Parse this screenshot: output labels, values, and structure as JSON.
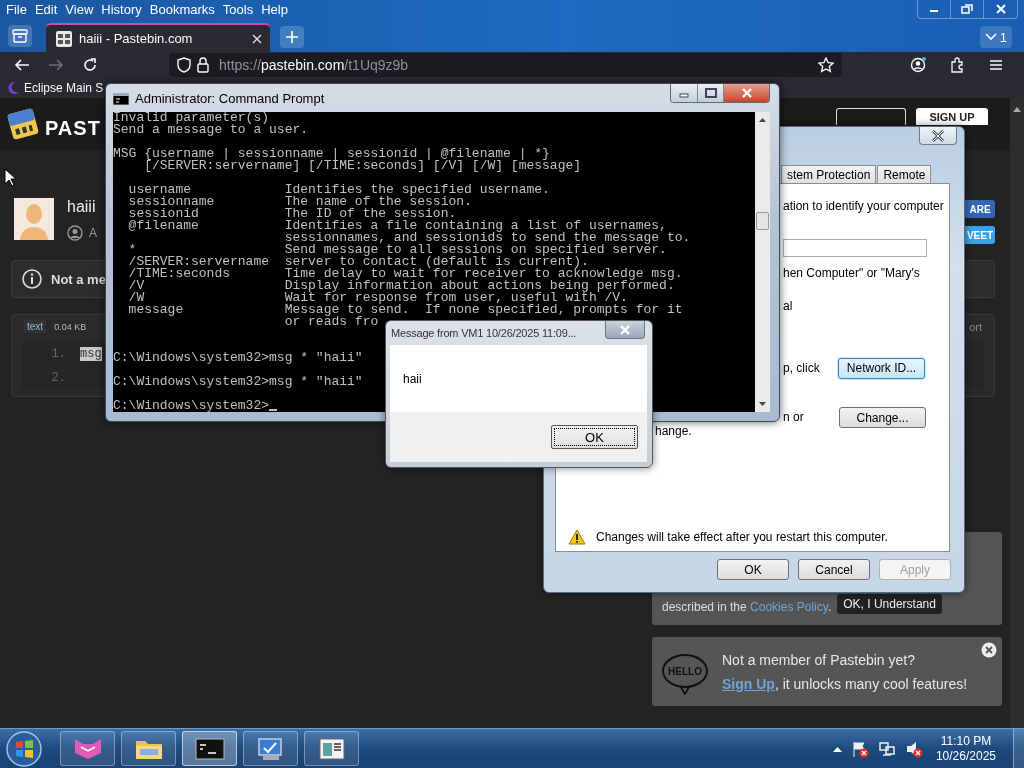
{
  "browser": {
    "menu": [
      "File",
      "Edit",
      "View",
      "History",
      "Bookmarks",
      "Tools",
      "Help"
    ],
    "tabs": [
      {
        "title": "haiii - Pastebin.com",
        "selected": true
      }
    ],
    "tab_count": "1",
    "url": {
      "scheme": "https://",
      "host": "pastebin.com",
      "path": "/t1Uq9z9b"
    },
    "bookmarks": [
      "Eclipse Main S"
    ]
  },
  "pastebin": {
    "logo_text": "PAST",
    "signup_button": "SIGN UP",
    "paste_title": "haiii",
    "author": "A",
    "notice": "Not a me",
    "syntax": "text",
    "size": "0.04 KB",
    "report": "ort",
    "share_buttons": [
      "ARE",
      "VEET"
    ],
    "lines": [
      {
        "number": "1.",
        "text": "msg",
        "selected": true
      },
      {
        "number": "2.",
        "selected": false
      }
    ],
    "cookie_banner": {
      "text": "described in the ",
      "link": "Cookies Policy",
      "after": ".",
      "button": "OK, I Understand"
    },
    "signup_banner": {
      "badge": "HELLO",
      "title": "Not a member of Pastebin yet?",
      "link": "Sign Up",
      "text": ", it unlocks many cool features!"
    }
  },
  "system_properties": {
    "tabs": [
      {
        "label": "stem Protection",
        "selected": false
      },
      {
        "label": "Remote",
        "selected": false
      }
    ],
    "description": "ation to identify your computer",
    "example": "hen Computer\" or \"Mary's",
    "label": "al",
    "network_text": "p, click",
    "network_button": "Network ID...",
    "change_text": [
      "n or",
      "hange."
    ],
    "change_button": "Change...",
    "warning": "Changes will take effect after you restart this computer.",
    "buttons": [
      {
        "label": "OK",
        "disabled": false
      },
      {
        "label": "Cancel",
        "disabled": false
      },
      {
        "label": "Apply",
        "disabled": true
      }
    ]
  },
  "command_prompt": {
    "title": "Administrator:  Command Prompt",
    "help": [
      [
        "Invalid parameter(s)",
        "Send a message to a user."
      ],
      [
        "MSG {username | sessionname | sessionid | @filename | *}",
        "    [/SERVER:servername] [/TIME:seconds] [/V] [/W] [message]"
      ],
      [
        "  username            Identifies the specified username.",
        "  sessionname         The name of the session.",
        "  sessionid           The ID of the session.",
        "  @filename           Identifies a file containing a list of usernames,",
        "                      sessionnames, and sessionids to send the message to.",
        "  *                   Send message to all sessions on specified server.",
        "  /SERVER:servername  server to contact (default is current).",
        "  /TIME:seconds       Time delay to wait for receiver to acknowledge msg.",
        "  /V                  Display information about actions being performed.",
        "  /W                  Wait for response from user, useful with /V.",
        "  message             Message to send.  If none specified, prompts for it",
        "                      or reads fro"
      ]
    ],
    "session": [
      "C:\\Windows\\system32>msg * \"haii\"",
      "C:\\Windows\\system32>msg * \"haii\"",
      "C:\\Windows\\system32>"
    ]
  },
  "message_box": {
    "title": "Message from VM1 10/26/2025 11:09...",
    "text": "haii",
    "button": "OK"
  },
  "taskbar": {
    "apps": [
      {
        "kind": "geometric",
        "active": false
      },
      {
        "kind": "folder",
        "active": false
      },
      {
        "kind": "console",
        "active": true
      },
      {
        "kind": "monitor",
        "active": false
      },
      {
        "kind": "document",
        "active": false
      }
    ],
    "clock": {
      "time": "11:10 PM",
      "date": "10/26/2025"
    }
  }
}
